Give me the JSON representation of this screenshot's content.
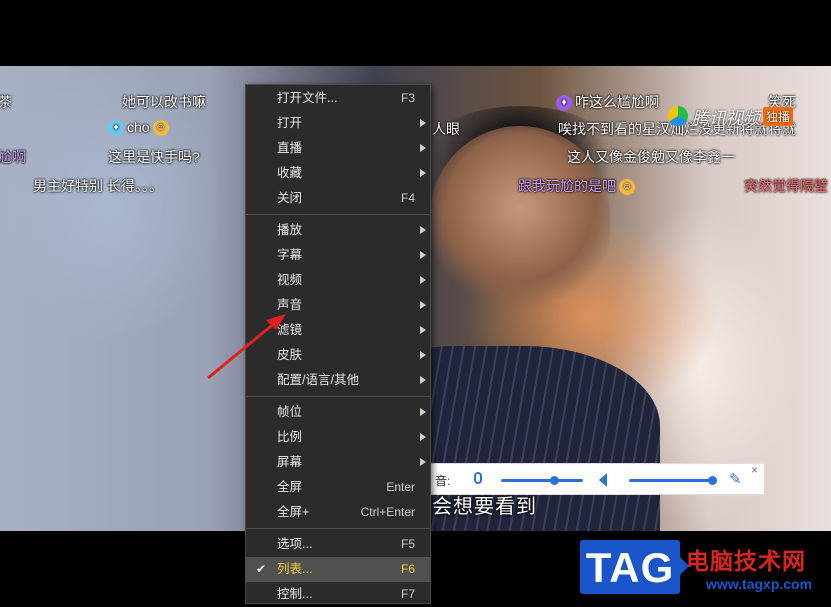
{
  "danmaku": [
    {
      "text": "茶",
      "style": "white"
    },
    {
      "text": "她可以改书嘛",
      "style": "white"
    },
    {
      "text": "cho",
      "style": "white"
    },
    {
      "text": "尬啊",
      "style": "purple"
    },
    {
      "text": "这里是快手吗?",
      "style": "white"
    },
    {
      "text": "男主好特别 长得。。。",
      "style": "white"
    },
    {
      "text": "咋这么尴尬啊",
      "style": "white"
    },
    {
      "text": "笑死",
      "style": "white"
    },
    {
      "text": "人眼",
      "style": "white"
    },
    {
      "text": "唉找不到看的星汉灿烂没更新将就将就",
      "style": "white"
    },
    {
      "text": "这人又像金俊勉又像李鑫一",
      "style": "white"
    },
    {
      "text": "跟我玩尬的是吧",
      "style": "purple"
    },
    {
      "text": "突然觉得隔壁",
      "style": "red"
    }
  ],
  "logo": {
    "name": "腾讯视频",
    "tag": "独播"
  },
  "subtitle": "会想要看到",
  "voicebar": {
    "label": "音:",
    "mic_level": 0.65,
    "volume_level": 0.97,
    "close": "×"
  },
  "menu": {
    "groups": [
      [
        {
          "label": "打开文件...",
          "shortcut": "F3",
          "submenu": false
        },
        {
          "label": "打开",
          "shortcut": "",
          "submenu": true
        },
        {
          "label": "直播",
          "shortcut": "",
          "submenu": true
        },
        {
          "label": "收藏",
          "shortcut": "",
          "submenu": true
        },
        {
          "label": "关闭",
          "shortcut": "F4",
          "submenu": false
        }
      ],
      [
        {
          "label": "播放",
          "shortcut": "",
          "submenu": true
        },
        {
          "label": "字幕",
          "shortcut": "",
          "submenu": true
        },
        {
          "label": "视频",
          "shortcut": "",
          "submenu": true
        },
        {
          "label": "声音",
          "shortcut": "",
          "submenu": true
        },
        {
          "label": "滤镜",
          "shortcut": "",
          "submenu": true
        },
        {
          "label": "皮肤",
          "shortcut": "",
          "submenu": true
        },
        {
          "label": "配置/语言/其他",
          "shortcut": "",
          "submenu": true
        }
      ],
      [
        {
          "label": "帧位",
          "shortcut": "",
          "submenu": true
        },
        {
          "label": "比例",
          "shortcut": "",
          "submenu": true
        },
        {
          "label": "屏幕",
          "shortcut": "",
          "submenu": true
        },
        {
          "label": "全屏",
          "shortcut": "Enter",
          "submenu": false
        },
        {
          "label": "全屏+",
          "shortcut": "Ctrl+Enter",
          "submenu": false
        }
      ],
      [
        {
          "label": "选项...",
          "shortcut": "F5",
          "submenu": false
        },
        {
          "label": "列表...",
          "shortcut": "F6",
          "submenu": false,
          "checked": true,
          "active": true
        },
        {
          "label": "控制...",
          "shortcut": "F7",
          "submenu": false
        }
      ]
    ]
  },
  "watermark": {
    "tag": "TAG",
    "title": "电脑技术网",
    "url": "www.tagxp.com"
  },
  "colors": {
    "menu_bg": "#2b2b2b",
    "active_text": "#f3d23c",
    "arrow": "#e02020",
    "accent": "#2e6fe0"
  }
}
